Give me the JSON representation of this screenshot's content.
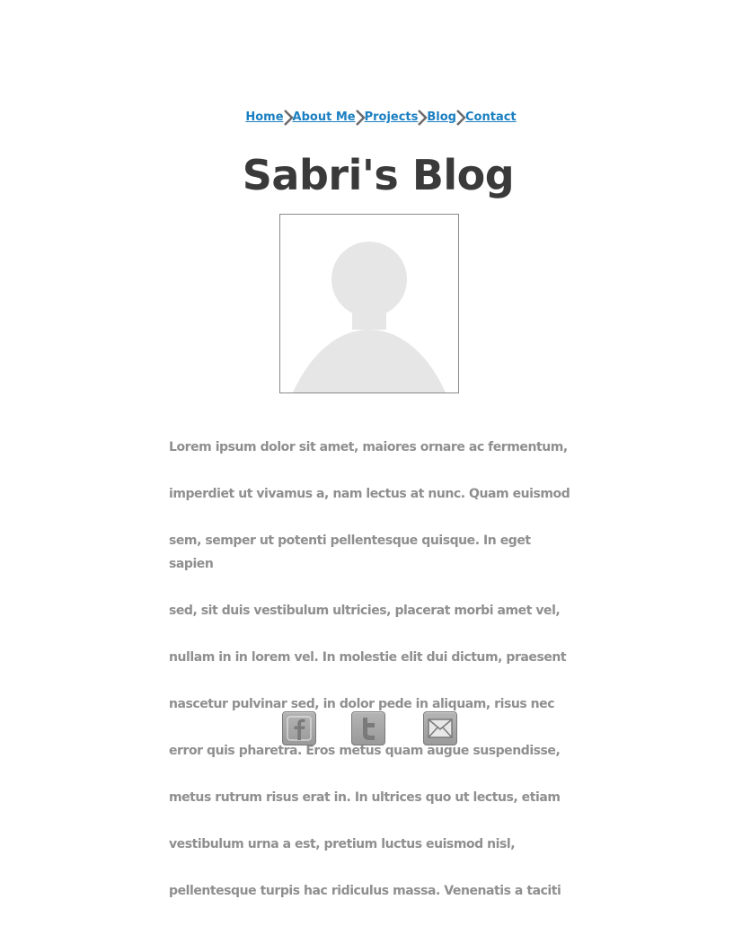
{
  "nav": {
    "items": [
      {
        "label": "Home"
      },
      {
        "label": "About Me"
      },
      {
        "label": "Projects"
      },
      {
        "label": "Blog"
      },
      {
        "label": "Contact"
      }
    ],
    "separator_icon": "chevron-right-icon",
    "link_color": "#1b7fc1"
  },
  "page": {
    "title": "Sabri's Blog",
    "avatar_icon": "user-silhouette-icon",
    "body_lines": [
      "Lorem ipsum dolor sit amet, maiores ornare ac fermentum,",
      "imperdiet ut vivamus a, nam lectus at nunc. Quam euismod",
      "sem, semper ut potenti pellentesque quisque. In eget sapien",
      "sed, sit duis vestibulum ultricies, placerat morbi amet vel,",
      "nullam in in lorem vel. In molestie elit dui dictum, praesent",
      "nascetur pulvinar sed, in dolor pede in aliquam, risus nec",
      "error quis pharetra. Eros metus quam augue suspendisse,",
      "metus rutrum risus erat in.  In ultrices quo ut lectus, etiam",
      "vestibulum urna a est, pretium luctus euismod nisl,",
      "pellentesque turpis hac ridiculus massa. Venenatis a taciti"
    ]
  },
  "social": {
    "icons": [
      "facebook-icon",
      "twitter-icon",
      "email-icon"
    ]
  },
  "colors": {
    "title": "#3a3a3a",
    "body_text": "#8f8f8f",
    "icon_gray": "#a8a8a8"
  }
}
